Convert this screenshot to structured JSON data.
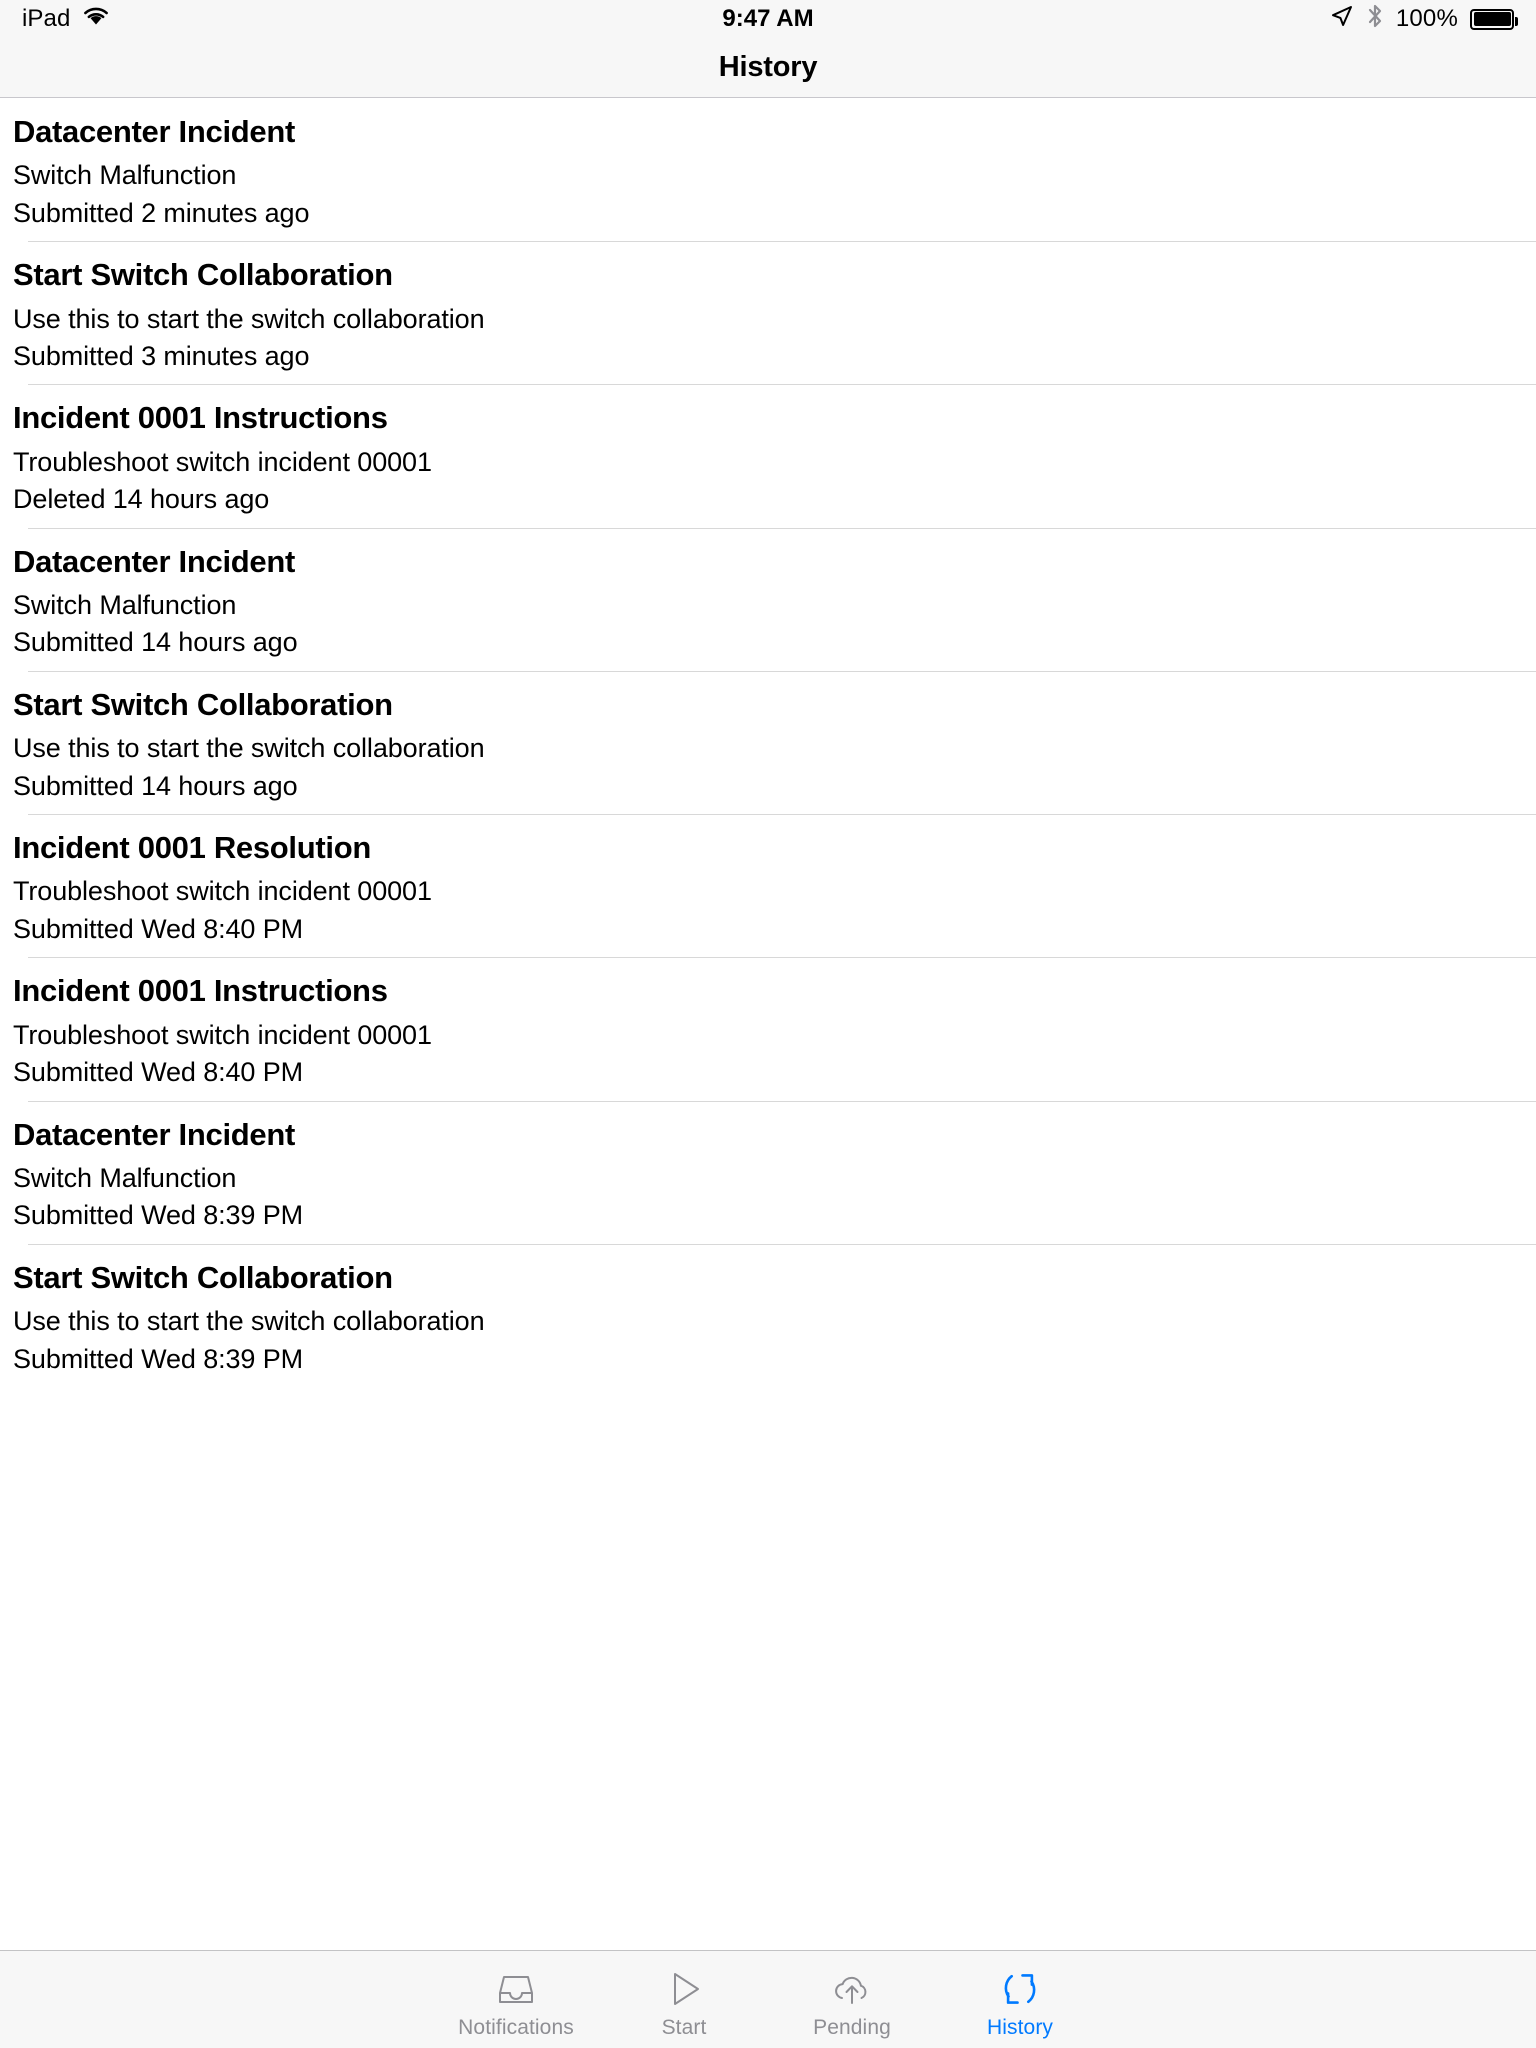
{
  "status_bar": {
    "device": "iPad",
    "wifi_icon": "wifi-icon",
    "time": "9:47 AM",
    "location_icon": "location-arrow-icon",
    "bluetooth_icon": "bluetooth-icon",
    "battery_percent": "100%",
    "battery_icon": "battery-full-icon"
  },
  "nav": {
    "title": "History"
  },
  "list": {
    "items": [
      {
        "title": "Datacenter Incident",
        "subtitle": "Switch Malfunction",
        "meta": "Submitted 2 minutes ago"
      },
      {
        "title": "Start Switch Collaboration",
        "subtitle": "Use this to start the switch collaboration",
        "meta": "Submitted 3 minutes ago"
      },
      {
        "title": "Incident 0001 Instructions",
        "subtitle": "Troubleshoot switch incident 00001",
        "meta": "Deleted 14 hours ago"
      },
      {
        "title": "Datacenter Incident",
        "subtitle": "Switch Malfunction",
        "meta": "Submitted 14 hours ago"
      },
      {
        "title": "Start Switch Collaboration",
        "subtitle": "Use this to start the switch collaboration",
        "meta": "Submitted 14 hours ago"
      },
      {
        "title": "Incident 0001 Resolution",
        "subtitle": "Troubleshoot switch incident 00001",
        "meta": "Submitted Wed 8:40 PM"
      },
      {
        "title": "Incident 0001 Instructions",
        "subtitle": "Troubleshoot switch incident 00001",
        "meta": "Submitted Wed 8:40 PM"
      },
      {
        "title": "Datacenter Incident",
        "subtitle": "Switch Malfunction",
        "meta": "Submitted Wed 8:39 PM"
      },
      {
        "title": "Start Switch Collaboration",
        "subtitle": "Use this to start the switch collaboration",
        "meta": "Submitted Wed 8:39 PM"
      }
    ]
  },
  "tabbar": {
    "active_color": "#007aff",
    "inactive_color": "#8e8e93",
    "tabs": [
      {
        "label": "Notifications",
        "icon": "inbox-tray-icon",
        "active": false
      },
      {
        "label": "Start",
        "icon": "play-triangle-icon",
        "active": false
      },
      {
        "label": "Pending",
        "icon": "cloud-upload-icon",
        "active": false
      },
      {
        "label": "History",
        "icon": "refresh-sync-icon",
        "active": true
      }
    ]
  }
}
